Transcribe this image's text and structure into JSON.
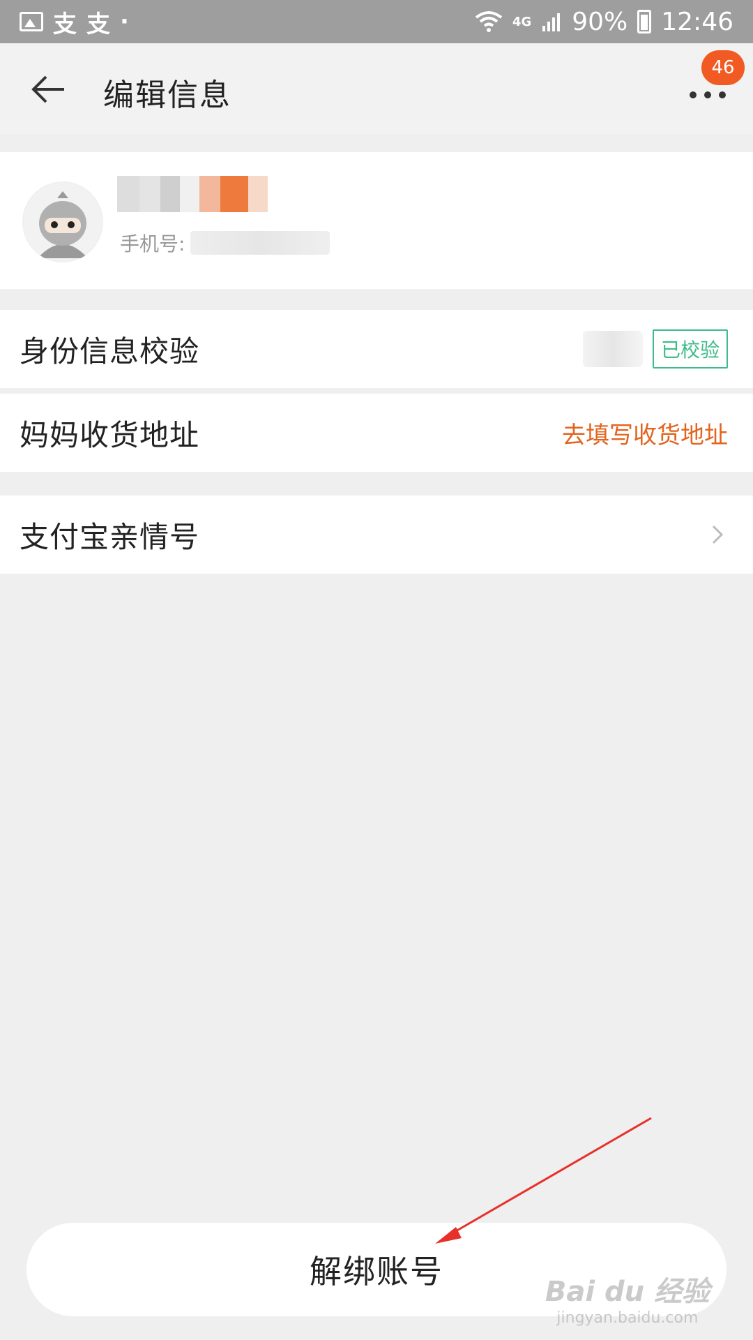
{
  "status_bar": {
    "app_glyphs": [
      "支",
      "支",
      "·"
    ],
    "network": "4G",
    "battery": "90%",
    "time": "12:46"
  },
  "header": {
    "title": "编辑信息",
    "badge_count": "46"
  },
  "profile": {
    "phone_label": "手机号:"
  },
  "rows": {
    "identity": {
      "label": "身份信息校验",
      "status": "已校验"
    },
    "address": {
      "label": "妈妈收货地址",
      "action": "去填写收货地址"
    },
    "alipay": {
      "label": "支付宝亲情号"
    }
  },
  "unbind_button": {
    "label": "解绑账号"
  },
  "watermark": {
    "main": "Bai du 经验",
    "sub": "jingyan.baidu.com"
  },
  "colors": {
    "accent_orange": "#e2641e",
    "badge_orange": "#f15a22",
    "verified_green": "#3dbb8a",
    "annotation_red": "#e8302a"
  }
}
